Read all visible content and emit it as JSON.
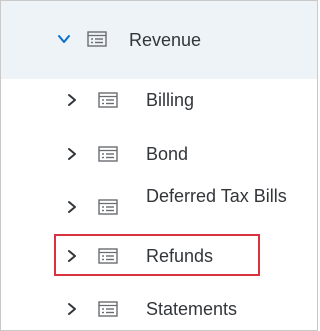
{
  "tree": {
    "parent": {
      "label": "Revenue",
      "expanded": true,
      "chevron_icon": "chevron-down-icon",
      "node_icon": "document-list-icon"
    },
    "children": [
      {
        "label": "Billing",
        "chevron_icon": "chevron-right-icon",
        "node_icon": "document-list-icon",
        "highlighted": false
      },
      {
        "label": "Bond",
        "chevron_icon": "chevron-right-icon",
        "node_icon": "document-list-icon",
        "highlighted": false
      },
      {
        "label": "Deferred Tax Bills",
        "chevron_icon": "chevron-right-icon",
        "node_icon": "document-list-icon",
        "highlighted": false
      },
      {
        "label": "Refunds",
        "chevron_icon": "chevron-right-icon",
        "node_icon": "document-list-icon",
        "highlighted": true
      },
      {
        "label": "Statements",
        "chevron_icon": "chevron-right-icon",
        "node_icon": "document-list-icon",
        "highlighted": false
      }
    ]
  },
  "colors": {
    "accent": "#0a6ed1",
    "highlight_border": "#d9333f",
    "parent_background": "#eef3f8",
    "text": "#32363a",
    "frame_border": "#c9c9c9"
  }
}
